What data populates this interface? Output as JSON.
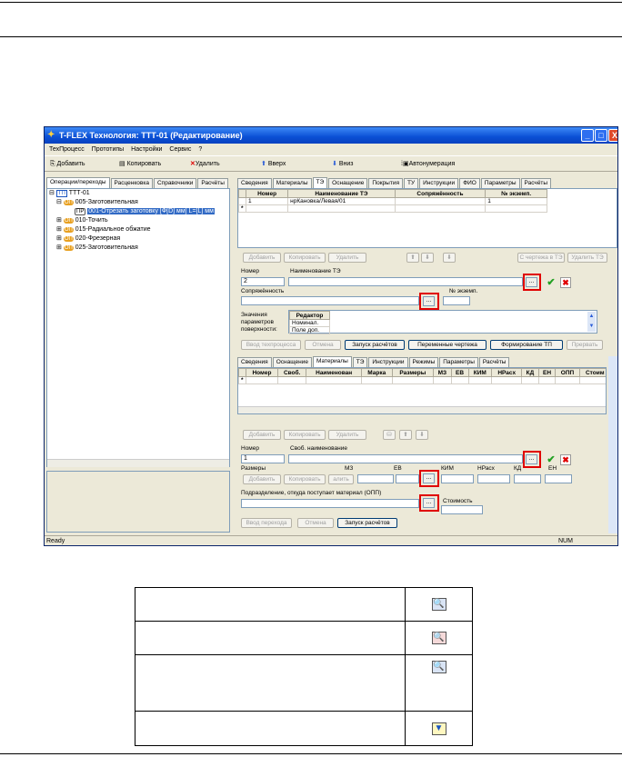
{
  "window": {
    "title": "T-FLEX Технология: ТТТ-01  (Редактирование)",
    "controls": {
      "min": "_",
      "max": "□",
      "close": "X"
    },
    "menu": [
      "ТехПроцесс",
      "Прототипы",
      "Настройки",
      "Сервис",
      "?"
    ],
    "toolbar": {
      "add": "Добавить",
      "copy": "Копировать",
      "delete": "Удалить",
      "up": "Вверх",
      "down": "Вниз",
      "autonum": "Автонумерация"
    },
    "status": {
      "left": "Ready",
      "num": "NUM"
    }
  },
  "left_panel": {
    "tabs": [
      "Операции/переходы",
      "Расценковка",
      "Справочники",
      "Расчёты"
    ],
    "tree": [
      {
        "badge": "ТП",
        "text": "ТТТ-01",
        "level": 0
      },
      {
        "badge": "ОП",
        "text": "005-Заготовительная",
        "level": 1
      },
      {
        "badge": "ПР",
        "text": "001-Отрезать заготовку [Ф[D] мм] L=[L] мм",
        "level": 2,
        "selected": true
      },
      {
        "badge": "ОП",
        "text": "010-Точить",
        "level": 1
      },
      {
        "badge": "ОП",
        "text": "015-Радиальное обжатие",
        "level": 1
      },
      {
        "badge": "ОП",
        "text": "020-Фрезерная",
        "level": 1
      },
      {
        "badge": "ОП",
        "text": "025-Заготовительная",
        "level": 1
      }
    ]
  },
  "top_right": {
    "tabs": [
      "Сведения",
      "Материалы",
      "ТЭ",
      "Оснащение",
      "Покрытия",
      "ТУ",
      "Инструкции",
      "ФИО",
      "Параметры",
      "Расчёты"
    ],
    "grid_headers": [
      "Номер",
      "Наименование ТЭ",
      "Сопряжённость",
      "№ экземп."
    ],
    "grid_rows": [
      [
        "1",
        "нрКановка/Левая/01",
        "",
        "1"
      ]
    ],
    "new_row_marker": "*",
    "buttons": {
      "add": "Добавить",
      "copy": "Копировать",
      "delete": "Удалить",
      "from_drawing": "С чертежа в ТЭ",
      "delete_te": "Удалить ТЭ"
    },
    "labels": {
      "number": "Номер",
      "name": "Наименование ТЭ",
      "conj": "Сопряжённость",
      "inst": "№ экземп.",
      "values": "Значения",
      "params": "параметров",
      "surface": "поверхности:"
    },
    "number_value": "2",
    "editor": {
      "header": "Редактор",
      "rows": [
        "Номинал.",
        "Поле доп."
      ]
    },
    "action_buttons": [
      "Ввод техпроцесса",
      "Отмена",
      "Запуск расчётов",
      "Переменные чертежа",
      "Формирование ТП",
      "Прервать"
    ]
  },
  "bottom_right": {
    "tabs": [
      "Сведения",
      "Оснащение",
      "Материалы",
      "ТЭ",
      "Инструкции",
      "Режимы",
      "Параметры",
      "Расчёты"
    ],
    "grid_headers": [
      "Номер",
      "Своб.",
      "Наименован",
      "Марка",
      "Размеры",
      "МЗ",
      "ЕВ",
      "КИМ",
      "НРасх",
      "КД",
      "ЕН",
      "ОПП",
      "Стоим"
    ],
    "new_row_marker": "*",
    "buttons": {
      "add": "Добавить",
      "copy": "Копировать",
      "delete": "Удалить",
      "add2": "Добавить",
      "copy2": "Копировать",
      "delete2": "алить"
    },
    "labels": {
      "number": "Номер",
      "name": "Своб. наименование",
      "sizes": "Размеры",
      "mz": "МЗ",
      "ev": "ЕВ",
      "kim": "КИМ",
      "nrash": "НРасх",
      "kd": "КД",
      "en": "ЕН",
      "dept": "Подразделение, откуда поступает материал (ОПП)",
      "cost": "Стоимость"
    },
    "number_value": "1",
    "action_buttons": [
      "Ввод перехода",
      "Отмена",
      "Запуск расчётов"
    ]
  },
  "dots_label": "...",
  "legend_table": [
    {
      "text": "",
      "icon": "binoculars-icon",
      "glyph": "🔍"
    },
    {
      "text": "",
      "icon": "binoculars-red-icon",
      "glyph": "🔍"
    },
    {
      "text": "",
      "icon": "find-table-icon",
      "glyph": "🔍"
    },
    {
      "text": "",
      "icon": "filter-icon",
      "glyph": "▼"
    }
  ]
}
